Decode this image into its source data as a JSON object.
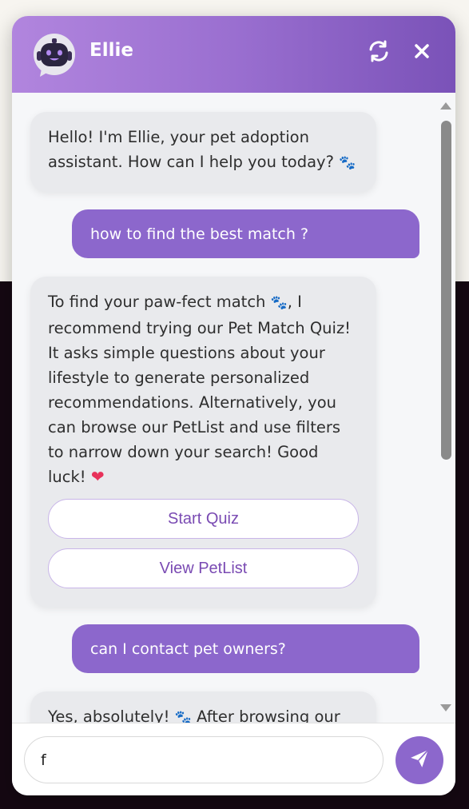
{
  "header": {
    "title": "Ellie",
    "avatar_icon": "robot-icon",
    "refresh_icon": "refresh-icon",
    "close_icon": "close-icon"
  },
  "messages": [
    {
      "role": "bot",
      "text": "Hello! I'm Ellie, your pet adoption assistant. How can I help you today? ",
      "emoji": "🐾"
    },
    {
      "role": "user",
      "text": "how to find the best match ?"
    },
    {
      "role": "bot",
      "text_before": "To find your paw-fect match ",
      "emoji_mid": "🐾",
      "text_after": ", I recommend trying our Pet Match Quiz! It asks simple questions about your lifestyle to generate personalized recommendations. Alternatively, you can browse our PetList and use filters to narrow down your search! Good luck! ",
      "emoji_end": "❤",
      "buttons": [
        "Start Quiz",
        "View PetList"
      ]
    },
    {
      "role": "user",
      "text": "can I contact pet owners?"
    },
    {
      "role": "bot",
      "text_before": "Yes, absolutely! ",
      "emoji_mid": "🐾",
      "text_after": " After browsing our"
    }
  ],
  "input": {
    "value": "f",
    "placeholder": ""
  },
  "send_icon": "send-icon",
  "colors": {
    "accent": "#8c67cc",
    "header_start": "#b185de",
    "header_end": "#7a52b8",
    "bot_bubble": "#e9eaed",
    "button_text": "#7a4bb3"
  }
}
